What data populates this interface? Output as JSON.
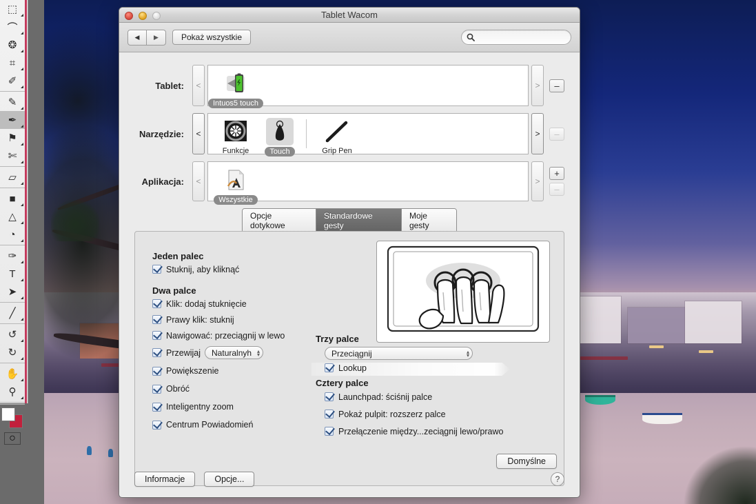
{
  "window": {
    "title": "Tablet Wacom",
    "show_all_label": "Pokaż wszystkie",
    "search_placeholder": "",
    "search_value": "",
    "nav_back": "◀",
    "nav_forward": "▶"
  },
  "rows": [
    {
      "label": "Tablet:",
      "prev": "<",
      "next": ">",
      "remove": "–",
      "add": null,
      "items": [
        {
          "label": "Intuos5 touch",
          "icon": "battery-icon",
          "selected": true
        }
      ]
    },
    {
      "label": "Narzędzie:",
      "prev": "<",
      "next": ">",
      "remove": "–",
      "add": null,
      "items": [
        {
          "label": "Funkcje",
          "icon": "touch-ring-icon",
          "selected": false
        },
        {
          "label": "Touch",
          "icon": "finger-icon",
          "selected": true
        },
        {
          "label": "Grip Pen",
          "icon": "pen-icon",
          "selected": false
        }
      ]
    },
    {
      "label": "Aplikacja:",
      "prev": "<",
      "next": ">",
      "remove": "–",
      "add": "+",
      "items": [
        {
          "label": "Wszystkie",
          "icon": "all-apps-icon",
          "selected": true
        }
      ]
    }
  ],
  "tabs": [
    {
      "label": "Opcje dotykowe",
      "active": false
    },
    {
      "label": "Standardowe gesty",
      "active": true
    },
    {
      "label": "Moje gesty",
      "active": false
    }
  ],
  "panel": {
    "groups": {
      "one_finger": {
        "title": "Jeden palec",
        "options": [
          {
            "label": "Stuknij, aby kliknąć",
            "checked": true
          }
        ]
      },
      "two_fingers": {
        "title": "Dwa palce",
        "options": [
          {
            "label": "Klik: dodaj stuknięcie",
            "checked": true
          },
          {
            "label": "Prawy klik: stuknij",
            "checked": true
          },
          {
            "label": "Nawigować: przeciągnij w lewo",
            "checked": true
          },
          {
            "label": "Przewijaj",
            "checked": true,
            "popup": "Naturalnyh"
          },
          {
            "label": "Powiększenie",
            "checked": true
          },
          {
            "label": "Obróć",
            "checked": true
          },
          {
            "label": "Inteligentny zoom",
            "checked": true
          },
          {
            "label": "Centrum Powiadomień",
            "checked": true
          }
        ]
      },
      "three_fingers": {
        "title": "Trzy palce",
        "popup": "Przeciągnij",
        "options": [
          {
            "label": "Lookup",
            "checked": true
          }
        ]
      },
      "four_fingers": {
        "title": "Cztery palce",
        "options": [
          {
            "label": "Launchpad: ściśnij palce",
            "checked": true
          },
          {
            "label": "Pokaż pulpit: rozszerz palce",
            "checked": true
          },
          {
            "label": "Przełączenie między...zeciągnij lewo/prawo",
            "checked": true
          }
        ]
      }
    },
    "defaults_label": "Domyślne"
  },
  "footer": {
    "info_label": "Informacje",
    "options_label": "Opcje...",
    "help_label": "?"
  },
  "toolbar": {
    "tools": [
      {
        "name": "marquee-tool",
        "glyph": "⬚",
        "selected": false
      },
      {
        "name": "lasso-tool",
        "glyph": "⌒",
        "selected": false
      },
      {
        "name": "quick-selection-tool",
        "glyph": "❂",
        "selected": false
      },
      {
        "name": "crop-tool",
        "glyph": "⌗",
        "selected": false
      },
      {
        "name": "eyedropper-tool",
        "glyph": "✐",
        "selected": false
      },
      {
        "name": "healing-brush-tool",
        "glyph": "✎",
        "selected": false
      },
      {
        "name": "brush-tool",
        "glyph": "✒",
        "selected": true
      },
      {
        "name": "clone-stamp-tool",
        "glyph": "⚑",
        "selected": false
      },
      {
        "name": "history-brush-tool",
        "glyph": "✄",
        "selected": false
      },
      {
        "name": "eraser-tool",
        "glyph": "▱",
        "selected": false
      },
      {
        "name": "gradient-tool",
        "glyph": "■",
        "selected": false
      },
      {
        "name": "blur-tool",
        "glyph": "△",
        "selected": false
      },
      {
        "name": "dodge-tool",
        "glyph": "◔",
        "selected": false
      },
      {
        "name": "pen-tool",
        "glyph": "✑",
        "selected": false
      },
      {
        "name": "type-tool",
        "glyph": "T",
        "selected": false
      },
      {
        "name": "path-selection-tool",
        "glyph": "➤",
        "selected": false
      },
      {
        "name": "line-tool",
        "glyph": "╱",
        "selected": false
      },
      {
        "name": "rotate-3d-tool",
        "glyph": "↺",
        "selected": false
      },
      {
        "name": "orbit-3d-tool",
        "glyph": "↻",
        "selected": false
      },
      {
        "name": "hand-tool",
        "glyph": "✋",
        "selected": false
      },
      {
        "name": "zoom-tool",
        "glyph": "⚲",
        "selected": false
      }
    ],
    "foreground_color": "#ffffff",
    "background_color": "#c2203c",
    "quick_mask_glyph": "◯"
  }
}
